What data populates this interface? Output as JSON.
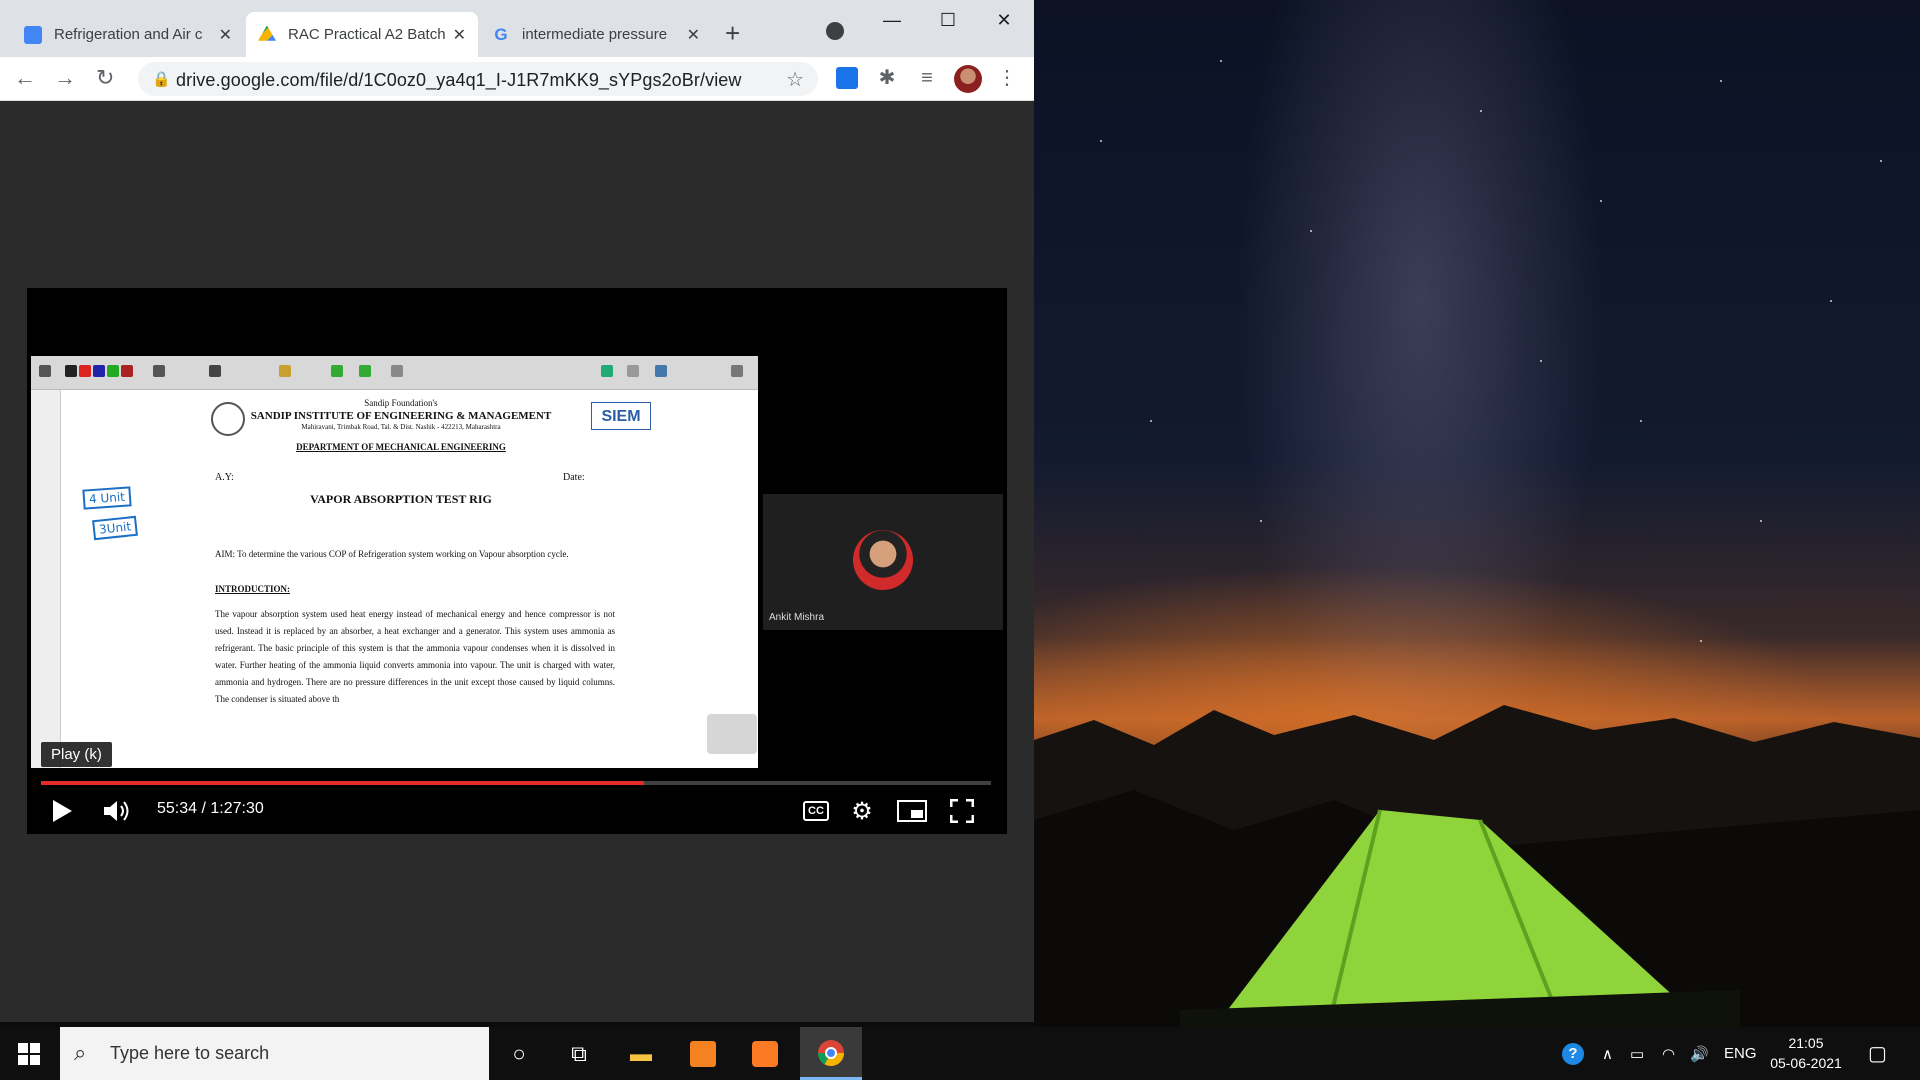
{
  "browser": {
    "tabs": [
      {
        "label": "Refrigeration and Air c",
        "favicon_color": "#4285f4"
      },
      {
        "label": "RAC Practical A2 Batch",
        "favicon_color": "#0f9d58"
      },
      {
        "label": "intermediate pressure",
        "favicon_color": "#ea4335"
      }
    ],
    "url": "drive.google.com/file/d/1C0oz0_ya4q1_I-J1R7mKK9_sYPgs2oBr/view"
  },
  "player": {
    "tooltip": "Play (k)",
    "time": "55:34 / 1:27:30",
    "progress_fraction": 0.635,
    "progress_color": "#e52d27",
    "cc_label": "CC"
  },
  "slide": {
    "foundation": "Sandip Foundation's",
    "institute": "SANDIP INSTITUTE OF ENGINEERING & MANAGEMENT",
    "address": "Mahiravani, Trimbak Road, Tal. & Dist. Nashik - 422213, Maharashtra",
    "logo_text": "SIEM",
    "department": "DEPARTMENT OF MECHANICAL ENGINEERING",
    "ay": "A.Y:",
    "date": "Date:",
    "experiment": "VAPOR ABSORPTION TEST RIG",
    "aim": "AIM: To determine the various COP of Refrigeration system working on Vapour absorption cycle.",
    "intro_heading": "INTRODUCTION:",
    "intro_body": "The vapour absorption system used heat energy instead of mechanical energy and hence compressor is not used. Instead it is replaced by an absorber, a heat exchanger and a generator. This system uses ammonia as refrigerant. The basic principle of this system is that the ammonia vapour condenses when it is dissolved in water. Further heating of the ammonia liquid converts ammonia into vapour. The unit is charged with water, ammonia and hydrogen. There are no pressure differences in the unit except those caused by liquid columns. The condenser is situated above th",
    "annotation_1": "4 Unit",
    "annotation_2": "3Unit"
  },
  "participant": {
    "name": "Ankit Mishra"
  },
  "taskbar": {
    "search_placeholder": "Type here to search",
    "language": "ENG",
    "time": "21:05",
    "date": "05-06-2021"
  },
  "colors": {
    "accent": "#7ab8f5",
    "tent": "#8fd43a"
  }
}
